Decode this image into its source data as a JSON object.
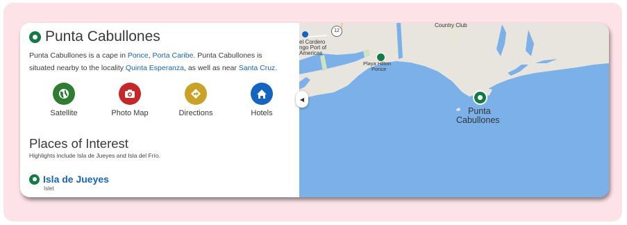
{
  "place": {
    "title": "Punta Cabullones",
    "desc_1": "Punta Cabullones is a cape in ",
    "link_ponce": "Ponce",
    "sep_1": ", ",
    "link_porta_caribe": "Porta Caribe",
    "desc_2": ". Punta Cabullones is situated nearby to the locality ",
    "link_quinta": "Quinta Esperanza",
    "desc_3": ", as well as near ",
    "link_santa_cruz": "Santa Cruz",
    "desc_4": "."
  },
  "actions": [
    {
      "label": "Satellite",
      "icon": "globe-icon",
      "color": "#2e7d32"
    },
    {
      "label": "Photo Map",
      "icon": "camera-icon",
      "color": "#c62828"
    },
    {
      "label": "Directions",
      "icon": "directions-icon",
      "color": "#c9a227"
    },
    {
      "label": "Hotels",
      "icon": "home-icon",
      "color": "#1565c0"
    }
  ],
  "poi": {
    "heading": "Places of Interest",
    "subtitle": "Highlights include Isla de Jueyes and Isla del Frío.",
    "items": [
      {
        "name": "Isla de Jueyes",
        "type": "Islet"
      }
    ]
  },
  "map": {
    "road_badge": "12",
    "country_club": "Country Club",
    "el_cordero_1": "el Cordero",
    "el_cordero_2": "ngo Port of",
    "el_cordero_3": "Americas",
    "playa_1": "Playa Hilton",
    "playa_2": "Ponce",
    "marker_1": "Punta",
    "marker_2": "Cabullones",
    "collapse_icon": "chevron-left-icon"
  },
  "colors": {
    "accent_green": "#137a45",
    "link_blue": "#1565c0",
    "water": "#7bb0e8",
    "land": "#e8e5df",
    "frame_pink": "#fde3e8"
  }
}
